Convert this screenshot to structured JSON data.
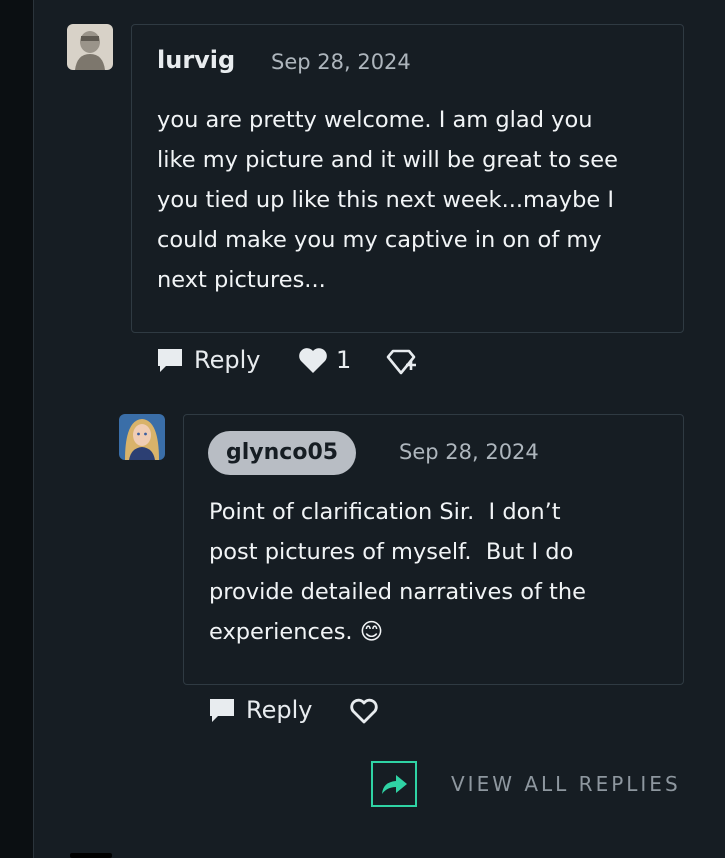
{
  "comments": [
    {
      "username": "lurvig",
      "date": "Sep 28, 2024",
      "body": "you are pretty welcome. I am glad you\nlike my picture and it will be great to see\nyou tied up like this next week...maybe I\ncould make you my captive in on of my\nnext pictures...",
      "reply_label": "Reply",
      "like_count": "1",
      "avatar_icon": "avatar-sketch"
    },
    {
      "username": "glynco05",
      "date": "Sep 28, 2024",
      "body": "Point of clarification Sir.  I don’t\npost pictures of myself.  But I do\nprovide detailed narratives of the\nexperiences. 😊",
      "reply_label": "Reply",
      "avatar_icon": "avatar-blonde-woman"
    }
  ],
  "view_all_replies": "VIEW ALL REPLIES",
  "colors": {
    "panel_bg": "#161d23",
    "accent_teal": "#2fd3a4",
    "pill_bg": "#b8bdc4"
  }
}
